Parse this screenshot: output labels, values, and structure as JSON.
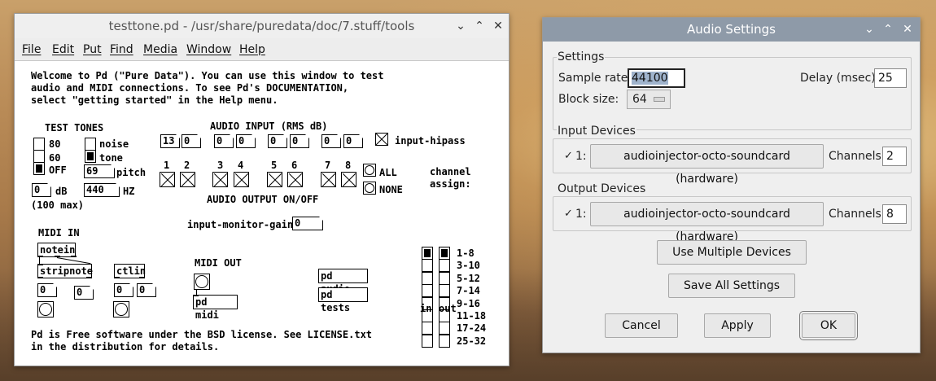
{
  "pd_window": {
    "title": "testtone.pd  - /usr/share/puredata/doc/7.stuff/tools",
    "menu": [
      "File",
      "Edit",
      "Put",
      "Find",
      "Media",
      "Window",
      "Help"
    ],
    "intro": "Welcome to Pd (\"Pure Data\"). You can use this window to test\naudio and MIDI connections. To see Pd's DOCUMENTATION,\nselect \"getting started\" in the Help menu.",
    "test_tones": {
      "heading": "TEST TONES",
      "level_80": "80",
      "level_60": "60",
      "level_off": "OFF",
      "noise": "noise",
      "tone": "tone",
      "pitch_value": "69",
      "pitch_label": "pitch",
      "db_value": "0",
      "db_label": "dB",
      "hz_value": "440",
      "hz_label": "HZ",
      "max_note": "(100 max)"
    },
    "audio_input": {
      "heading": "AUDIO INPUT (RMS dB)",
      "meters": [
        "13",
        "0",
        "0",
        "0",
        "0",
        "0",
        "0",
        "0"
      ],
      "hipass_label": "input-hipass"
    },
    "audio_output": {
      "channel_numbers": [
        "1",
        "2",
        "3",
        "4",
        "5",
        "6",
        "7",
        "8"
      ],
      "all_label": "ALL",
      "none_label": "NONE",
      "heading": "AUDIO OUTPUT ON/OFF"
    },
    "monitor": {
      "label": "input-monitor-gain",
      "value": "0"
    },
    "channel_assign": {
      "heading": "channel\nassign:",
      "ranges": [
        "1-8",
        "3-10",
        "5-12",
        "7-14",
        "9-16",
        "11-18",
        "17-24",
        "25-32"
      ],
      "in_label": "in",
      "out_label": "out"
    },
    "midi_in": {
      "heading": "MIDI IN",
      "notein": "notein",
      "stripnote": "stripnote",
      "ctlin": "ctlin",
      "note_values": [
        "0",
        "0"
      ],
      "ctl_values": [
        "0",
        "0"
      ]
    },
    "midi_out": {
      "heading": "MIDI OUT",
      "pd_midi": "pd midi"
    },
    "subpatches": {
      "audio": "pd audio",
      "tests": "pd tests"
    },
    "license": "Pd is Free software under the BSD license. See LICENSE.txt\nin the distribution for details."
  },
  "audio_settings": {
    "title": "Audio Settings",
    "settings_label": "Settings",
    "sample_rate_label": "Sample rate:",
    "sample_rate_value": "44100",
    "delay_label": "Delay (msec):",
    "delay_value": "25",
    "block_size_label": "Block size:",
    "block_size_value": "64",
    "input_devices_label": "Input Devices",
    "input_device_index": "1:",
    "input_device_name": "audioinjector-octo-soundcard (hardware)",
    "input_channels_label": "Channels:",
    "input_channels_value": "2",
    "output_devices_label": "Output Devices",
    "output_device_index": "1:",
    "output_device_name": "audioinjector-octo-soundcard (hardware)",
    "output_channels_label": "Channels:",
    "output_channels_value": "8",
    "use_multiple_label": "Use Multiple Devices",
    "save_all_label": "Save All Settings",
    "cancel_label": "Cancel",
    "apply_label": "Apply",
    "ok_label": "OK",
    "checkbox_glyph": "✓"
  },
  "window_controls": {
    "minimize": "⌄",
    "maximize": "⌃",
    "close": "✕"
  }
}
